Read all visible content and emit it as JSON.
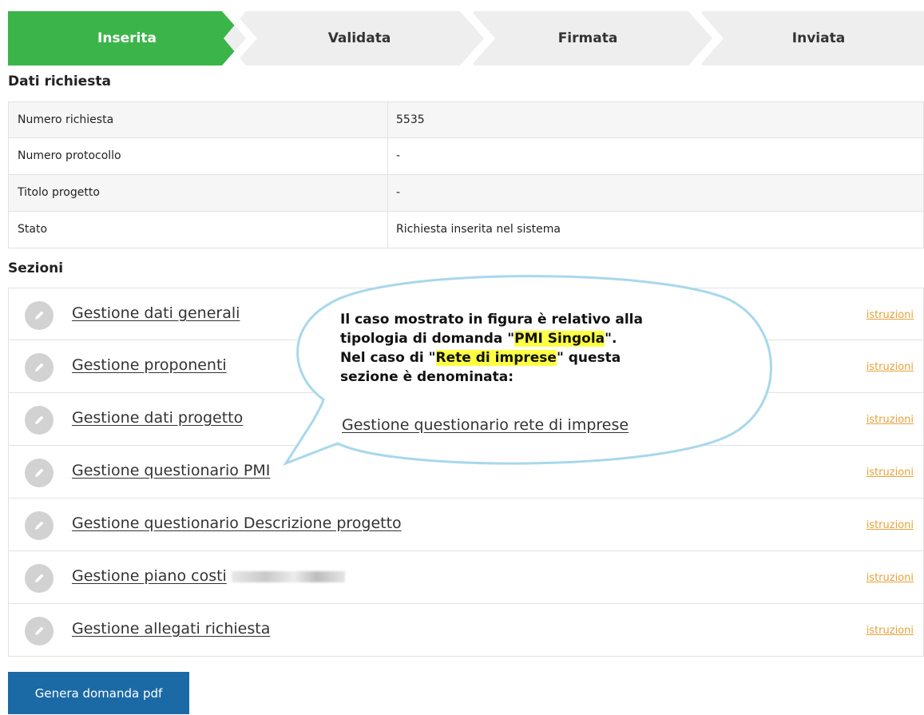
{
  "stepper": {
    "steps": [
      {
        "label": "Inserita",
        "active": true
      },
      {
        "label": "Validata",
        "active": false
      },
      {
        "label": "Firmata",
        "active": false
      },
      {
        "label": "Inviata",
        "active": false
      }
    ],
    "active_color": "#3bb54a",
    "inactive_color": "#eeeeee"
  },
  "dati_richiesta": {
    "title": "Dati richiesta",
    "rows": [
      {
        "label": "Numero richiesta",
        "value": "5535"
      },
      {
        "label": "Numero protocollo",
        "value": "-"
      },
      {
        "label": "Titolo progetto",
        "value": "-"
      },
      {
        "label": "Stato",
        "value": "Richiesta inserita nel sistema"
      }
    ]
  },
  "sezioni": {
    "title": "Sezioni",
    "help_label": "istruzioni",
    "items": [
      {
        "label": "Gestione dati generali",
        "icon": "pencil-icon"
      },
      {
        "label": "Gestione proponenti",
        "icon": "pencil-icon"
      },
      {
        "label": "Gestione dati progetto",
        "icon": "pencil-icon"
      },
      {
        "label": "Gestione questionario PMI",
        "icon": "pencil-icon"
      },
      {
        "label": "Gestione questionario Descrizione progetto",
        "icon": "pencil-icon"
      },
      {
        "label": "Gestione piano costi",
        "icon": "pencil-icon",
        "redacted_suffix": true
      },
      {
        "label": "Gestione allegati richiesta",
        "icon": "pencil-icon"
      }
    ]
  },
  "callout": {
    "line1": "Il caso mostrato in figura è relativo alla",
    "line2_prefix": "tipologia di domanda \"",
    "line2_highlight": "PMI Singola",
    "line2_suffix": "\".",
    "line3_prefix": "Nel caso di \"",
    "line3_highlight": "Rete di imprese",
    "line3_suffix": "\" questa",
    "line4": "sezione è denominata:",
    "link_label": "Gestione questionario rete di imprese"
  },
  "button": {
    "label": "Genera domanda pdf",
    "color": "#1b6aa6"
  }
}
